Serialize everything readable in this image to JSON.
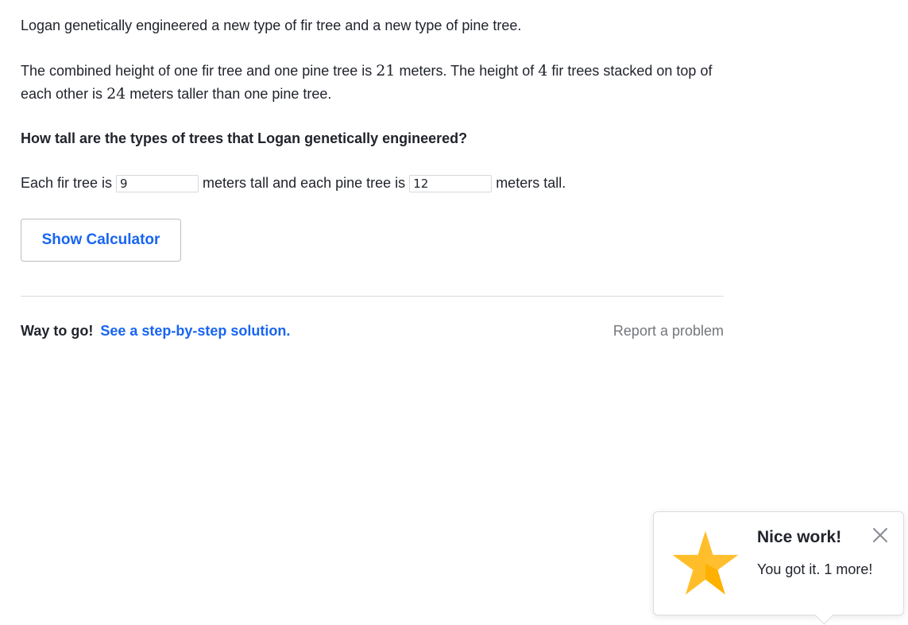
{
  "problem": {
    "intro": "Logan genetically engineered a new type of fir tree and a new type of pine tree.",
    "body_part1": "The combined height of one fir tree and one pine tree is ",
    "body_num1": "21",
    "body_part2": " meters. The height of ",
    "body_num2": "4",
    "body_part3": " fir trees stacked on top of each other is ",
    "body_num3": "24",
    "body_part4": " meters taller than one pine tree.",
    "question": "How tall are the types of trees that Logan genetically engineered?"
  },
  "answer": {
    "prefix": "Each fir tree is",
    "fir_value": "9",
    "middle": "meters tall and each pine tree is",
    "pine_value": "12",
    "suffix": "meters tall."
  },
  "calculator": {
    "label": "Show Calculator"
  },
  "footer": {
    "feedback": "Way to go!",
    "solution_link": "See a step-by-step solution.",
    "report_link": "Report a problem"
  },
  "toast": {
    "title": "Nice work!",
    "message": "You got it. 1 more!",
    "icon": "star-icon",
    "star_color": "#ffb100"
  },
  "colors": {
    "link_blue": "#1865f2",
    "text": "#21242c",
    "muted": "#73767c"
  }
}
